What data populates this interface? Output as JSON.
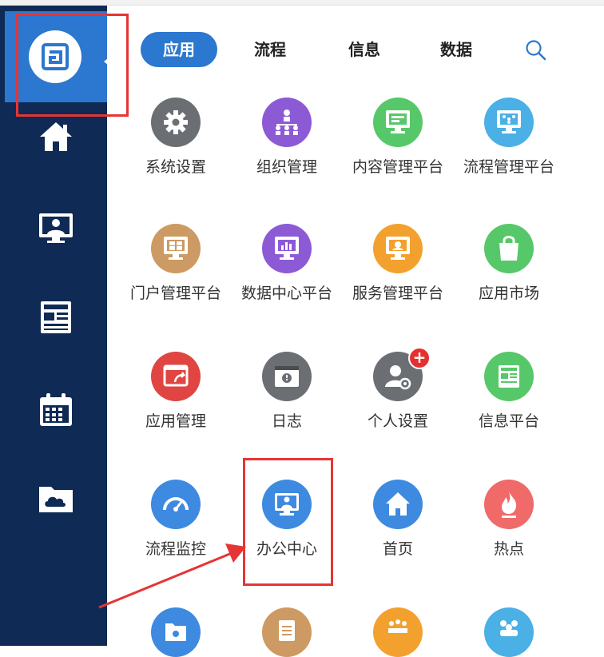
{
  "tabs": [
    {
      "label": "应用",
      "active": true
    },
    {
      "label": "流程",
      "active": false
    },
    {
      "label": "信息",
      "active": false
    },
    {
      "label": "数据",
      "active": false
    }
  ],
  "apps": [
    {
      "label": "系统设置",
      "color": "#6b6f73",
      "icon": "gear-icon"
    },
    {
      "label": "组织管理",
      "color": "#8d5ad6",
      "icon": "org-chart-icon"
    },
    {
      "label": "内容管理平台",
      "color": "#57c86a",
      "icon": "content-icon"
    },
    {
      "label": "流程管理平台",
      "color": "#4ab0e6",
      "icon": "flow-icon"
    },
    {
      "label": "门户管理平台",
      "color": "#cc9a62",
      "icon": "portal-icon"
    },
    {
      "label": "数据中心平台",
      "color": "#8d5ad6",
      "icon": "chart-icon"
    },
    {
      "label": "服务管理平台",
      "color": "#f3a12e",
      "icon": "service-icon"
    },
    {
      "label": "应用市场",
      "color": "#57c86a",
      "icon": "bag-icon"
    },
    {
      "label": "应用管理",
      "color": "#e04542",
      "icon": "app-manage-icon"
    },
    {
      "label": "日志",
      "color": "#6b6f73",
      "icon": "log-icon"
    },
    {
      "label": "个人设置",
      "color": "#6b6f73",
      "icon": "user-settings-icon",
      "badge": "+"
    },
    {
      "label": "信息平台",
      "color": "#57c86a",
      "icon": "news-icon"
    },
    {
      "label": "流程监控",
      "color": "#3d8ae0",
      "icon": "gauge-icon"
    },
    {
      "label": "办公中心",
      "color": "#3d8ae0",
      "icon": "office-icon"
    },
    {
      "label": "首页",
      "color": "#3d8ae0",
      "icon": "home-icon"
    },
    {
      "label": "热点",
      "color": "#f06a6a",
      "icon": "fire-icon"
    },
    {
      "label": "",
      "color": "#3d8ae0",
      "icon": "folder-icon"
    },
    {
      "label": "",
      "color": "#cc9a62",
      "icon": "note-icon"
    },
    {
      "label": "",
      "color": "#f3a12e",
      "icon": "team-icon"
    },
    {
      "label": "",
      "color": "#4ab0e6",
      "icon": "people-icon"
    }
  ],
  "colors": {
    "sidebar": "#0f2a54",
    "accent": "#2c77cf",
    "highlight": "#e53535"
  }
}
